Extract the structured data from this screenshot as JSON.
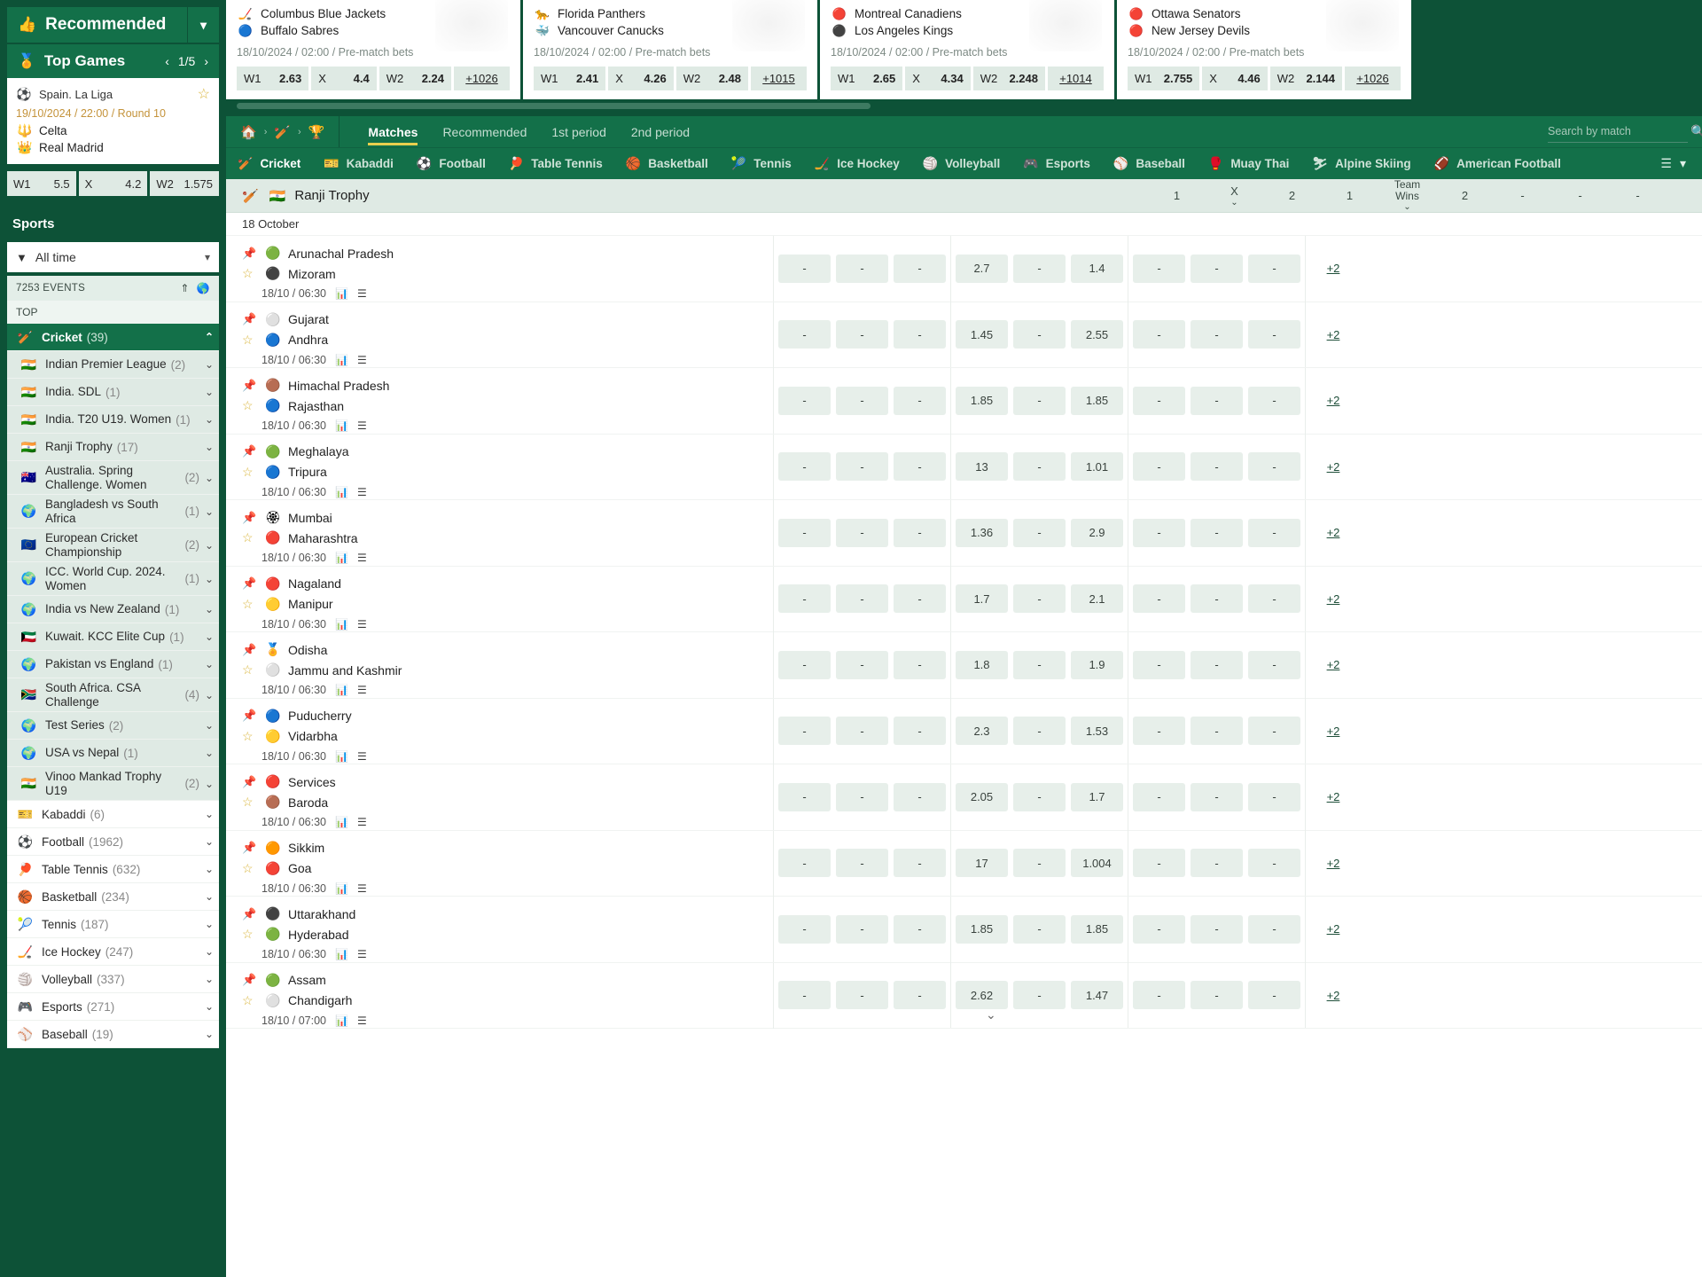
{
  "sidebar": {
    "recommended": {
      "label": "Recommended",
      "icon": "thumbs-up-icon",
      "caret": "chevron-down-icon"
    },
    "top_games": {
      "label": "Top Games",
      "icon": "award-icon",
      "page": "1/5",
      "prev": "‹",
      "next": "›"
    },
    "featured_match": {
      "league": "Spain. La Liga",
      "league_flag": "⚽",
      "datetime": "19/10/2024 / 22:00 / Round 10",
      "team1": "Celta",
      "team1_logo": "🔱",
      "team2": "Real Madrid",
      "team2_logo": "👑",
      "odds": [
        {
          "label": "W1",
          "value": "5.5"
        },
        {
          "label": "X",
          "value": "4.2"
        },
        {
          "label": "W2",
          "value": "1.575"
        }
      ]
    },
    "sports_header": "Sports",
    "time_filter": {
      "label": "All time",
      "icon": "funnel-icon"
    },
    "events_count": "7253 EVENTS",
    "top_label": "TOP",
    "items": [
      {
        "label": "Cricket",
        "count": "(39)",
        "flag": "🏏",
        "active": true,
        "chevron": "chevron-up-icon",
        "sub": false
      },
      {
        "label": "Indian Premier League",
        "count": "(2)",
        "flag": "🇮🇳",
        "active": false,
        "chevron": "chevron-down-icon",
        "sub": true
      },
      {
        "label": "India. SDL",
        "count": "(1)",
        "flag": "🇮🇳",
        "active": false,
        "chevron": "chevron-down-icon",
        "sub": true
      },
      {
        "label": "India. T20 U19. Women",
        "count": "(1)",
        "flag": "🇮🇳",
        "active": false,
        "chevron": "chevron-down-icon",
        "sub": true
      },
      {
        "label": "Ranji Trophy",
        "count": "(17)",
        "flag": "🇮🇳",
        "active": false,
        "chevron": "chevron-down-icon",
        "sub": true
      },
      {
        "label": "Australia. Spring Challenge. Women",
        "count": "(2)",
        "flag": "🇦🇺",
        "active": false,
        "chevron": "chevron-down-icon",
        "sub": true
      },
      {
        "label": "Bangladesh vs South Africa",
        "count": "(1)",
        "flag": "🌍",
        "active": false,
        "chevron": "chevron-down-icon",
        "sub": true
      },
      {
        "label": "European Cricket Championship",
        "count": "(2)",
        "flag": "🇪🇺",
        "active": false,
        "chevron": "chevron-down-icon",
        "sub": true
      },
      {
        "label": "ICC. World Cup. 2024. Women",
        "count": "(1)",
        "flag": "🌍",
        "active": false,
        "chevron": "chevron-down-icon",
        "sub": true
      },
      {
        "label": "India vs New Zealand",
        "count": "(1)",
        "flag": "🌍",
        "active": false,
        "chevron": "chevron-down-icon",
        "sub": true
      },
      {
        "label": "Kuwait. KCC Elite Cup",
        "count": "(1)",
        "flag": "🇰🇼",
        "active": false,
        "chevron": "chevron-down-icon",
        "sub": true
      },
      {
        "label": "Pakistan vs England",
        "count": "(1)",
        "flag": "🌍",
        "active": false,
        "chevron": "chevron-down-icon",
        "sub": true
      },
      {
        "label": "South Africa. CSA Challenge",
        "count": "(4)",
        "flag": "🇿🇦",
        "active": false,
        "chevron": "chevron-down-icon",
        "sub": true
      },
      {
        "label": "Test Series",
        "count": "(2)",
        "flag": "🌍",
        "active": false,
        "chevron": "chevron-down-icon",
        "sub": true
      },
      {
        "label": "USA vs Nepal",
        "count": "(1)",
        "flag": "🌍",
        "active": false,
        "chevron": "chevron-down-icon",
        "sub": true
      },
      {
        "label": "Vinoo Mankad Trophy U19",
        "count": "(2)",
        "flag": "🇮🇳",
        "active": false,
        "chevron": "chevron-down-icon",
        "sub": true
      },
      {
        "label": "Kabaddi",
        "count": "(6)",
        "flag": "🎫",
        "active": false,
        "chevron": "chevron-down-icon",
        "sub": false
      },
      {
        "label": "Football",
        "count": "(1962)",
        "flag": "⚽",
        "active": false,
        "chevron": "chevron-down-icon",
        "sub": false
      },
      {
        "label": "Table Tennis",
        "count": "(632)",
        "flag": "🏓",
        "active": false,
        "chevron": "chevron-down-icon",
        "sub": false
      },
      {
        "label": "Basketball",
        "count": "(234)",
        "flag": "🏀",
        "active": false,
        "chevron": "chevron-down-icon",
        "sub": false
      },
      {
        "label": "Tennis",
        "count": "(187)",
        "flag": "🎾",
        "active": false,
        "chevron": "chevron-down-icon",
        "sub": false
      },
      {
        "label": "Ice Hockey",
        "count": "(247)",
        "flag": "🏒",
        "active": false,
        "chevron": "chevron-down-icon",
        "sub": false
      },
      {
        "label": "Volleyball",
        "count": "(337)",
        "flag": "🏐",
        "active": false,
        "chevron": "chevron-down-icon",
        "sub": false
      },
      {
        "label": "Esports",
        "count": "(271)",
        "flag": "🎮",
        "active": false,
        "chevron": "chevron-down-icon",
        "sub": false
      },
      {
        "label": "Baseball",
        "count": "(19)",
        "flag": "⚾",
        "active": false,
        "chevron": "chevron-down-icon",
        "sub": false
      }
    ]
  },
  "banner": {
    "promos": [
      {
        "team1": "Columbus Blue Jackets",
        "team1_logo": "🏒",
        "team2": "Buffalo Sabres",
        "team2_logo": "🔵",
        "meta": "18/10/2024 / 02:00 / Pre-match bets",
        "odds": [
          {
            "label": "W1",
            "value": "2.63"
          },
          {
            "label": "X",
            "value": "4.4"
          },
          {
            "label": "W2",
            "value": "2.24"
          }
        ],
        "more": "+1026"
      },
      {
        "team1": "Florida Panthers",
        "team1_logo": "🐆",
        "team2": "Vancouver Canucks",
        "team2_logo": "🐳",
        "meta": "18/10/2024 / 02:00 / Pre-match bets",
        "odds": [
          {
            "label": "W1",
            "value": "2.41"
          },
          {
            "label": "X",
            "value": "4.26"
          },
          {
            "label": "W2",
            "value": "2.48"
          }
        ],
        "more": "+1015"
      },
      {
        "team1": "Montreal Canadiens",
        "team1_logo": "🔴",
        "team2": "Los Angeles Kings",
        "team2_logo": "⚫",
        "meta": "18/10/2024 / 02:00 / Pre-match bets",
        "odds": [
          {
            "label": "W1",
            "value": "2.65"
          },
          {
            "label": "X",
            "value": "4.34"
          },
          {
            "label": "W2",
            "value": "2.248"
          }
        ],
        "more": "+1014"
      },
      {
        "team1": "Ottawa Senators",
        "team1_logo": "🔴",
        "team2": "New Jersey Devils",
        "team2_logo": "🔴",
        "meta": "18/10/2024 / 02:00 / Pre-match bets",
        "odds": [
          {
            "label": "W1",
            "value": "2.755"
          },
          {
            "label": "X",
            "value": "4.46"
          },
          {
            "label": "W2",
            "value": "2.144"
          }
        ],
        "more": "+1026"
      }
    ]
  },
  "nav": {
    "breadcrumb": [
      {
        "icon": "home-icon",
        "glyph": "🏠"
      },
      {
        "icon": "cricket-bat-icon",
        "glyph": "🏏"
      },
      {
        "icon": "trophy-icon",
        "glyph": "🏆"
      }
    ],
    "tabs": [
      {
        "label": "Matches",
        "active": true
      },
      {
        "label": "Recommended",
        "active": false
      },
      {
        "label": "1st period",
        "active": false
      },
      {
        "label": "2nd period",
        "active": false
      }
    ],
    "search": {
      "placeholder": "Search by match",
      "value": "",
      "icon": "search-icon"
    }
  },
  "sportbar": {
    "items": [
      {
        "label": "Cricket",
        "glyph": "🏏",
        "icon": "cricket-icon",
        "active": true
      },
      {
        "label": "Kabaddi",
        "glyph": "🎫",
        "icon": "kabaddi-icon",
        "active": false
      },
      {
        "label": "Football",
        "glyph": "⚽",
        "icon": "football-icon",
        "active": false
      },
      {
        "label": "Table Tennis",
        "glyph": "🏓",
        "icon": "table-tennis-icon",
        "active": false
      },
      {
        "label": "Basketball",
        "glyph": "🏀",
        "icon": "basketball-icon",
        "active": false
      },
      {
        "label": "Tennis",
        "glyph": "🎾",
        "icon": "tennis-icon",
        "active": false
      },
      {
        "label": "Ice Hockey",
        "glyph": "🏒",
        "icon": "ice-hockey-icon",
        "active": false
      },
      {
        "label": "Volleyball",
        "glyph": "🏐",
        "icon": "volleyball-icon",
        "active": false
      },
      {
        "label": "Esports",
        "glyph": "🎮",
        "icon": "esports-icon",
        "active": false
      },
      {
        "label": "Baseball",
        "glyph": "⚾",
        "icon": "baseball-icon",
        "active": false
      },
      {
        "label": "Muay Thai",
        "glyph": "🥊",
        "icon": "muay-thai-icon",
        "active": false
      },
      {
        "label": "Alpine Skiing",
        "glyph": "⛷",
        "icon": "alpine-skiing-icon",
        "active": false
      },
      {
        "label": "American Football",
        "glyph": "🏈",
        "icon": "american-football-icon",
        "active": false
      }
    ],
    "more_icon": "hamburger-icon",
    "more_caret": "chevron-down-icon"
  },
  "table": {
    "league": {
      "name": "Ranji Trophy",
      "sport_icon": "cricket-bat-icon",
      "flag": "🇮🇳"
    },
    "columns": [
      {
        "label": "1",
        "caret": false
      },
      {
        "label": "X",
        "caret": true
      },
      {
        "label": "2",
        "caret": false
      },
      {
        "label": "1",
        "caret": false
      },
      {
        "label": "Team Wins",
        "caret": true
      },
      {
        "label": "2",
        "caret": false
      },
      {
        "label": "-",
        "caret": false
      },
      {
        "label": "-",
        "caret": false
      },
      {
        "label": "-",
        "caret": false
      }
    ],
    "date_group": "18 October",
    "rows": [
      {
        "team1": "Arunachal Pradesh",
        "team1_logo": "🟢",
        "team2": "Mizoram",
        "team2_logo": "⚫",
        "time": "18/10 / 06:30",
        "odds": [
          "-",
          "-",
          "-",
          "2.7",
          "-",
          "1.4",
          "-",
          "-",
          "-"
        ],
        "more": "+2"
      },
      {
        "team1": "Gujarat",
        "team1_logo": "⚪",
        "team2": "Andhra",
        "team2_logo": "🔵",
        "time": "18/10 / 06:30",
        "odds": [
          "-",
          "-",
          "-",
          "1.45",
          "-",
          "2.55",
          "-",
          "-",
          "-"
        ],
        "more": "+2"
      },
      {
        "team1": "Himachal Pradesh",
        "team1_logo": "🟤",
        "team2": "Rajasthan",
        "team2_logo": "🔵",
        "time": "18/10 / 06:30",
        "odds": [
          "-",
          "-",
          "-",
          "1.85",
          "-",
          "1.85",
          "-",
          "-",
          "-"
        ],
        "more": "+2"
      },
      {
        "team1": "Meghalaya",
        "team1_logo": "🟢",
        "team2": "Tripura",
        "team2_logo": "🔵",
        "time": "18/10 / 06:30",
        "odds": [
          "-",
          "-",
          "-",
          "13",
          "-",
          "1.01",
          "-",
          "-",
          "-"
        ],
        "more": "+2"
      },
      {
        "team1": "Mumbai",
        "team1_logo": "🏵",
        "team2": "Maharashtra",
        "team2_logo": "🔴",
        "time": "18/10 / 06:30",
        "odds": [
          "-",
          "-",
          "-",
          "1.36",
          "-",
          "2.9",
          "-",
          "-",
          "-"
        ],
        "more": "+2"
      },
      {
        "team1": "Nagaland",
        "team1_logo": "🔴",
        "team2": "Manipur",
        "team2_logo": "🟡",
        "time": "18/10 / 06:30",
        "odds": [
          "-",
          "-",
          "-",
          "1.7",
          "-",
          "2.1",
          "-",
          "-",
          "-"
        ],
        "more": "+2"
      },
      {
        "team1": "Odisha",
        "team1_logo": "🏅",
        "team2": "Jammu and Kashmir",
        "team2_logo": "⚪",
        "time": "18/10 / 06:30",
        "odds": [
          "-",
          "-",
          "-",
          "1.8",
          "-",
          "1.9",
          "-",
          "-",
          "-"
        ],
        "more": "+2"
      },
      {
        "team1": "Puducherry",
        "team1_logo": "🔵",
        "team2": "Vidarbha",
        "team2_logo": "🟡",
        "time": "18/10 / 06:30",
        "odds": [
          "-",
          "-",
          "-",
          "2.3",
          "-",
          "1.53",
          "-",
          "-",
          "-"
        ],
        "more": "+2"
      },
      {
        "team1": "Services",
        "team1_logo": "🔴",
        "team2": "Baroda",
        "team2_logo": "🟤",
        "time": "18/10 / 06:30",
        "odds": [
          "-",
          "-",
          "-",
          "2.05",
          "-",
          "1.7",
          "-",
          "-",
          "-"
        ],
        "more": "+2"
      },
      {
        "team1": "Sikkim",
        "team1_logo": "🟠",
        "team2": "Goa",
        "team2_logo": "🔴",
        "time": "18/10 / 06:30",
        "odds": [
          "-",
          "-",
          "-",
          "17",
          "-",
          "1.004",
          "-",
          "-",
          "-"
        ],
        "more": "+2"
      },
      {
        "team1": "Uttarakhand",
        "team1_logo": "⚫",
        "team2": "Hyderabad",
        "team2_logo": "🟢",
        "time": "18/10 / 06:30",
        "odds": [
          "-",
          "-",
          "-",
          "1.85",
          "-",
          "1.85",
          "-",
          "-",
          "-"
        ],
        "more": "+2"
      },
      {
        "team1": "Assam",
        "team1_logo": "🟢",
        "team2": "Chandigarh",
        "team2_logo": "⚪",
        "time": "18/10 / 07:00",
        "odds": [
          "-",
          "-",
          "-",
          "2.62",
          "-",
          "1.47",
          "-",
          "-",
          "-"
        ],
        "more": "+2"
      }
    ],
    "row_icons": {
      "pin": "pin-icon",
      "star": "star-icon",
      "stats": "stats-icon",
      "list": "list-icon"
    },
    "expand_caret": "chevron-down-icon"
  }
}
